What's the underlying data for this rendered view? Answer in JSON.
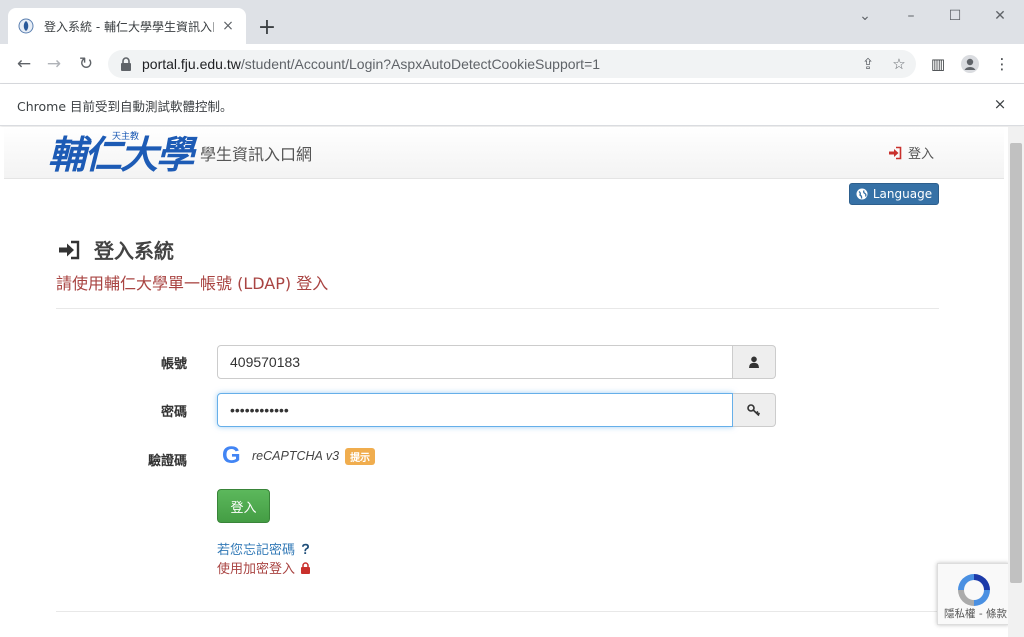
{
  "browser": {
    "tab": {
      "title": "登入系統 - 輔仁大學學生資訊入口",
      "close": "×"
    },
    "new_tab": "+",
    "url": {
      "host": "portal.fju.edu.tw",
      "path": "/student/Account/Login?AspxAutoDetectCookieSupport=1"
    },
    "infobar": {
      "text": "Chrome 目前受到自動測試軟體控制。",
      "close": "×"
    }
  },
  "header": {
    "logo_text": "輔仁大學",
    "logo_small": "天主教",
    "site_title": "學生資訊入口網",
    "login_link": "登入"
  },
  "language_button": "Language",
  "page": {
    "heading": "登入系統",
    "subtitle": "請使用輔仁大學單一帳號 (LDAP) 登入"
  },
  "form": {
    "account_label": "帳號",
    "account_value": "409570183",
    "password_label": "密碼",
    "password_value": "••••••••••••",
    "captcha_label": "驗證碼",
    "captcha_g": "G",
    "captcha_text": "reCAPTCHA v3",
    "hint_badge": "提示",
    "submit": "登入"
  },
  "links": {
    "forgot_password": "若您忘記密碼",
    "encrypted_login": "使用加密登入"
  },
  "recaptcha_badge": {
    "text": "隱私權 - 條款"
  },
  "colors": {
    "accent_blue": "#3671a6",
    "subtitle_red": "#a94442",
    "success_green": "#5cb85c",
    "hint_orange": "#f0ad4e",
    "link_blue": "#337ab7"
  }
}
